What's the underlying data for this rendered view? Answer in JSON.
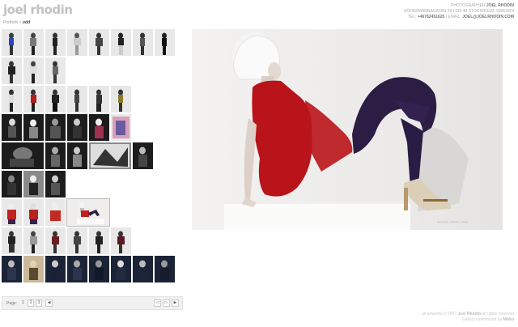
{
  "logo": "joel rhodin",
  "breadcrumb": {
    "parent": "Portfolio",
    "sep": "»",
    "current": "odd"
  },
  "contact": {
    "line1_prefix": "PHOTOGRAPHER",
    "line1_name": "JOEL RHODIN",
    "line2": "SÖDERMANNAGATAN 29 | 116 40 STOCKHOLM, SWEDEN",
    "line3_prefix": "TEL:",
    "phone": "+46762451625",
    "email_prefix": "| EMAIL:",
    "email": "JOEL@JOELRHODIN.COM"
  },
  "pager": {
    "label": "Page:",
    "pages": [
      "1",
      "2",
      "3"
    ],
    "current": "1",
    "prev_icon": "triangle-left-icon",
    "next_icon": "triangle-right-icon"
  },
  "main_image": {
    "credit": "Hammerøn / Rhodin / Nordic"
  },
  "footer": {
    "line1": "all artworks © 2007",
    "owner": "Joel Rhodin",
    "rights": "all rights reserved",
    "line2_prefix": "Gallery",
    "line2_mid": "customized by",
    "provider": "Nikko"
  }
}
